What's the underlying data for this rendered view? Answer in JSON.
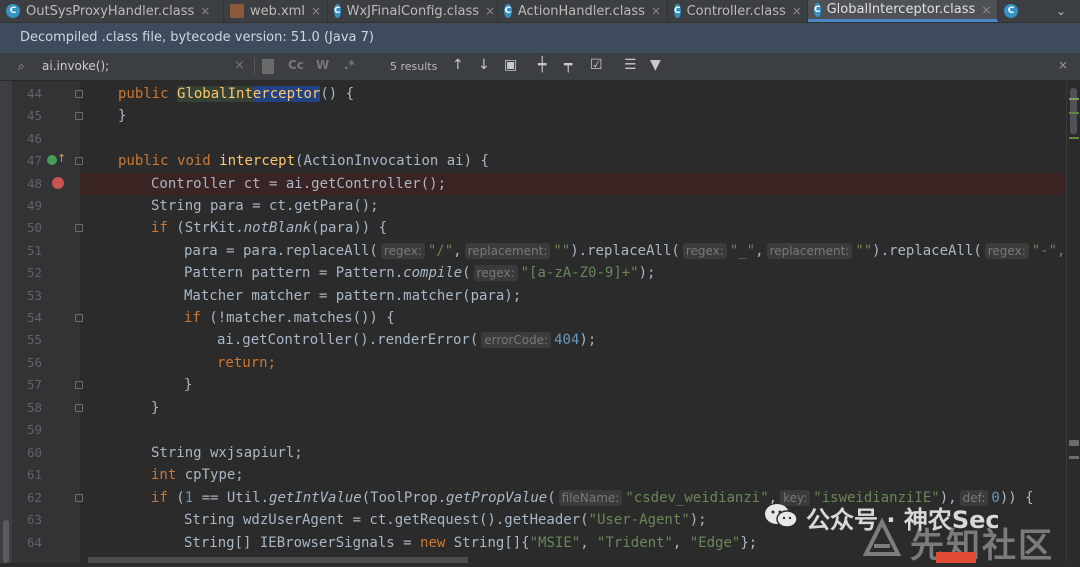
{
  "tabs": [
    {
      "label": "OutSysProxyHandler.class",
      "icon": "class-icon",
      "active": false
    },
    {
      "label": "web.xml",
      "icon": "xml-file-icon",
      "active": false
    },
    {
      "label": "WxJFinalConfig.class",
      "icon": "class-icon",
      "active": false
    },
    {
      "label": "ActionHandler.class",
      "icon": "class-icon",
      "active": false
    },
    {
      "label": "Controller.class",
      "icon": "class-icon",
      "active": false
    },
    {
      "label": "GlobalInterceptor.class",
      "icon": "class-icon",
      "active": true
    }
  ],
  "tab_icon_letter": "C",
  "tab_close": "×",
  "notice": "Decompiled .class file, bytecode version: 51.0 (Java 7)",
  "search": {
    "query": "ai.invoke();",
    "results": "5 results",
    "opt_case": "Cc",
    "opt_word": "W",
    "opt_regex": ".*"
  },
  "line_numbers": [
    "44",
    "45",
    "46",
    "47",
    "48",
    "49",
    "50",
    "51",
    "52",
    "53",
    "54",
    "55",
    "56",
    "57",
    "58",
    "59",
    "60",
    "61",
    "62",
    "63",
    "64"
  ],
  "code": {
    "l44": {
      "kw": "public",
      "ctor1": "GlobalInt",
      "ctor2": "erceptor",
      "rest": "() {"
    },
    "l45": "}",
    "l47": {
      "kw1": "public",
      "kw2": "void",
      "fn": "intercept",
      "rest": "(ActionInvocation ai) {"
    },
    "l48": "Controller ct = ai.getController();",
    "l49": "String para = ct.getPara();",
    "l50": {
      "kw": "if",
      "a": " (StrKit.",
      "it": "notBlank",
      "b": "(para)) {"
    },
    "l51": {
      "a": "para = para.replaceAll(",
      "h1": "regex:",
      "s1": "\"/\"",
      "c1": ",",
      "h2": "replacement:",
      "s2": "\"\"",
      "b": ").replaceAll(",
      "h3": "regex:",
      "s3": "\"_\"",
      "c2": ",",
      "h4": "replacement:",
      "s4": "\"\"",
      "c": ").replaceAll(",
      "h5": "regex:",
      "s5": "\"-\","
    },
    "l52": {
      "a": "Pattern pattern = Pattern.",
      "it": "compile",
      "b": "(",
      "h": "regex:",
      "s": "\"[a-zA-Z0-9]+\"",
      "c": ");"
    },
    "l53": "Matcher matcher = pattern.matcher(para);",
    "l54": {
      "kw": "if",
      "rest": " (!matcher.matches()) {"
    },
    "l55": {
      "a": "ai.getController().renderError(",
      "h": "errorCode:",
      "n": "404",
      "b": ");"
    },
    "l56": {
      "kw": "return",
      "rest": ";"
    },
    "l57": "}",
    "l58": "}",
    "l60": "String wxjsapiurl;",
    "l61": {
      "kw": "int",
      "rest": " cpType;"
    },
    "l62": {
      "kw": "if",
      "a": " (",
      "n1": "1",
      "b": " == Util.",
      "it1": "getIntValue",
      "c": "(ToolProp.",
      "it2": "getPropValue",
      "d": "(",
      "h1": "fileName:",
      "s1": "\"csdev_weidianzi\"",
      "e": ",",
      "h2": "key:",
      "s2": "\"isweidianziIE\"",
      "f": "),",
      "h3": "def:",
      "n2": "0",
      "g": ")) {"
    },
    "l63": {
      "a": "String wdzUserAgent = ct.getRequest().getHeader(",
      "s": "\"User-Agent\"",
      "b": ");"
    },
    "l64": {
      "a": "String[] IEBrowserSignals = ",
      "kw": "new",
      "b": " String[]{",
      "s1": "\"MSIE\"",
      "c1": ", ",
      "s2": "\"Trident\"",
      "c2": ", ",
      "s3": "\"Edge\"",
      "d": "};"
    }
  },
  "watermark": {
    "brand": "公众号 · 神农Sec",
    "site": "先知社区"
  }
}
